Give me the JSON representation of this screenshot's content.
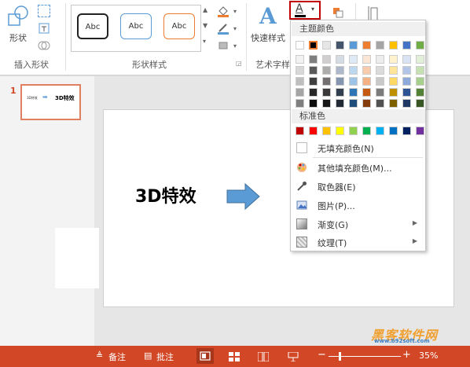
{
  "ribbon": {
    "shapes_label": "形状",
    "group_insert_shapes": "插入形状",
    "group_shape_styles": "形状样式",
    "group_art_styles": "艺术字样",
    "style_sample_text": "Abc",
    "quick_styles_label": "快速样式",
    "accent_red": "#c0392b"
  },
  "thumbnails": [
    {
      "number": "1",
      "text_left": "3D特效",
      "text_right": "3D特效"
    }
  ],
  "slide": {
    "title_text": "3D特效",
    "arrow_color": "#5b9bd5"
  },
  "dropdown": {
    "theme_colors_header": "主题颜色",
    "standard_colors_header": "标准色",
    "no_fill_label": "无填充颜色(N)",
    "more_colors_label": "其他填充颜色(M)...",
    "eyedropper_label": "取色器(E)",
    "picture_label": "图片(P)...",
    "gradient_label": "渐变(G)",
    "texture_label": "纹理(T)",
    "theme_row": [
      "#ffffff",
      "#000000",
      "#e7e6e6",
      "#44546a",
      "#5b9bd5",
      "#ed7d31",
      "#a5a5a5",
      "#ffc000",
      "#4472c4",
      "#70ad47"
    ],
    "theme_shades": [
      [
        "#f2f2f2",
        "#7f7f7f",
        "#d0cece",
        "#d6dce4",
        "#deebf6",
        "#fbe5d5",
        "#ededed",
        "#fff2cc",
        "#dae3f3",
        "#e2efd9"
      ],
      [
        "#d8d8d8",
        "#595959",
        "#aeabab",
        "#adb9ca",
        "#bdd7ee",
        "#f7cbac",
        "#dbdbdb",
        "#fee599",
        "#b4c6e7",
        "#c5e0b3"
      ],
      [
        "#bfbfbf",
        "#3f3f3f",
        "#757070",
        "#8496b0",
        "#9dc3e6",
        "#f4b183",
        "#c9c9c9",
        "#ffd965",
        "#8eaadb",
        "#a8d08d"
      ],
      [
        "#a5a5a5",
        "#262626",
        "#3a3838",
        "#323f4f",
        "#2e75b5",
        "#c55a11",
        "#7b7b7b",
        "#bf9000",
        "#2f5496",
        "#538135"
      ],
      [
        "#7f7f7f",
        "#0c0c0c",
        "#171616",
        "#222a35",
        "#1e4e79",
        "#843c0c",
        "#525252",
        "#7f6000",
        "#1f3864",
        "#375623"
      ]
    ],
    "standard_row": [
      "#c00000",
      "#ff0000",
      "#ffc000",
      "#ffff00",
      "#92d050",
      "#00b050",
      "#00b0f0",
      "#0070c0",
      "#002060",
      "#7030a0"
    ]
  },
  "statusbar": {
    "notes_label": "备注",
    "comments_label": "批注",
    "zoom_minus": "−",
    "zoom_plus": "+",
    "zoom_percent": "35%",
    "zoom_level": 0.35,
    "watermark_text": "黑客软件网",
    "watermark_url": "www.b92soft.com"
  }
}
